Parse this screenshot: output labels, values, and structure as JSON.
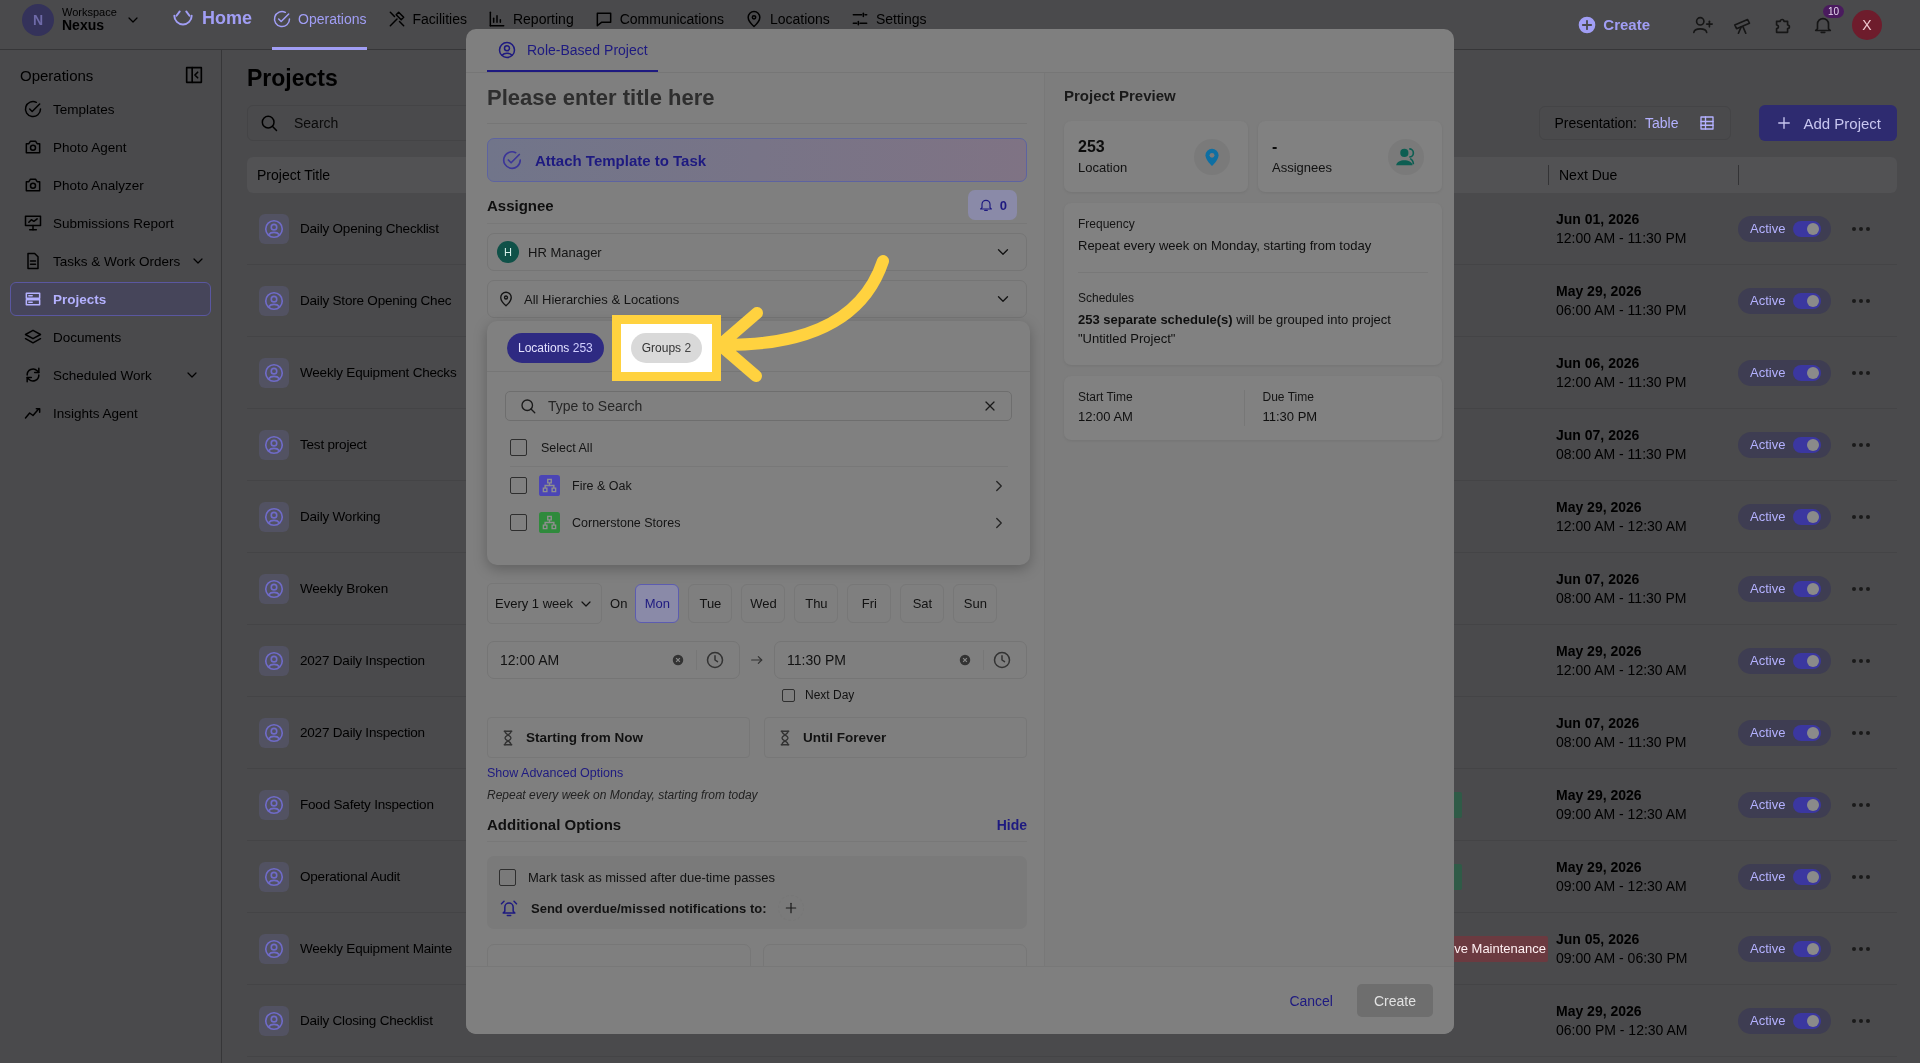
{
  "top_nav": {
    "workspace_label": "Workspace",
    "workspace_name": "Nexus",
    "workspace_initial": "N",
    "items": [
      {
        "label": "Home",
        "selected": false
      },
      {
        "label": "Operations",
        "selected": true
      },
      {
        "label": "Facilities",
        "selected": false
      },
      {
        "label": "Reporting",
        "selected": false
      },
      {
        "label": "Communications",
        "selected": false
      },
      {
        "label": "Locations",
        "selected": false
      },
      {
        "label": "Settings",
        "selected": false
      }
    ],
    "create_label": "Create",
    "notification_count": "10",
    "user_initial": "X"
  },
  "sidebar": {
    "title": "Operations",
    "items": [
      {
        "label": "Templates",
        "selected": false,
        "has_submenu": false
      },
      {
        "label": "Photo Agent",
        "selected": false,
        "has_submenu": false
      },
      {
        "label": "Photo Analyzer",
        "selected": false,
        "has_submenu": false
      },
      {
        "label": "Submissions Report",
        "selected": false,
        "has_submenu": false
      },
      {
        "label": "Tasks & Work Orders",
        "selected": false,
        "has_submenu": true
      },
      {
        "label": "Projects",
        "selected": true,
        "has_submenu": false
      },
      {
        "label": "Documents",
        "selected": false,
        "has_submenu": false
      },
      {
        "label": "Scheduled Work",
        "selected": false,
        "has_submenu": true
      },
      {
        "label": "Insights Agent",
        "selected": false,
        "has_submenu": false
      }
    ]
  },
  "page": {
    "title": "Projects",
    "search_placeholder": "Search",
    "presentation_label": "Presentation:",
    "presentation_value": "Table",
    "add_button": "Add Project"
  },
  "table": {
    "columns": [
      {
        "label": "Project Title"
      },
      {
        "label": "Next Due"
      }
    ],
    "rows": [
      {
        "title": "Daily Opening Checklist",
        "due_date": "Jun 01, 2026",
        "due_time": "12:00 AM - 11:30 PM",
        "status": "Active",
        "active": true
      },
      {
        "title": "Daily Store Opening Chec",
        "due_date": "May 29, 2026",
        "due_time": "06:00 AM - 11:30 PM",
        "status": "Active",
        "active": true
      },
      {
        "title": "Weekly Equipment Checks",
        "due_date": "Jun 06, 2026",
        "due_time": "12:00 AM - 11:30 PM",
        "status": "Active",
        "active": true
      },
      {
        "title": "Test project",
        "due_date": "Jun 07, 2026",
        "due_time": "08:00 AM - 11:30 PM",
        "status": "Active",
        "active": true
      },
      {
        "title": "Daily Working",
        "due_date": "May 29, 2026",
        "due_time": "12:00 AM - 12:30 AM",
        "status": "Active",
        "active": true
      },
      {
        "title": "Weekly Broken",
        "due_date": "Jun 07, 2026",
        "due_time": "08:00 AM - 11:30 PM",
        "status": "Active",
        "active": true
      },
      {
        "title": "2027 Daily Inspection",
        "due_date": "May 29, 2026",
        "due_time": "12:00 AM - 12:30 AM",
        "status": "Active",
        "active": true
      },
      {
        "title": "2027 Daily Inspection",
        "due_date": "Jun 07, 2026",
        "due_time": "08:00 AM - 11:30 PM",
        "status": "Active",
        "active": true
      },
      {
        "title": "Food Safety Inspection",
        "tag": {
          "color": "#2f5b47"
        },
        "due_date": "May 29, 2026",
        "due_time": "09:00 AM - 12:30 AM",
        "status": "Active",
        "active": true
      },
      {
        "title": "Operational Audit",
        "tag": {
          "color": "#2f5b47"
        },
        "due_date": "May 29, 2026",
        "due_time": "09:00 AM - 12:30 AM",
        "status": "Active",
        "active": true
      },
      {
        "title": "Weekly Equipment Mainte",
        "tag": {
          "text": "ve Maintenance",
          "color": "#6b3a40"
        },
        "due_date": "Jun 05, 2026",
        "due_time": "09:00 AM - 06:30 PM",
        "status": "Active",
        "active": true
      },
      {
        "title": "Daily Closing Checklist",
        "due_date": "May 29, 2026",
        "due_time": "06:00 PM - 12:30 AM",
        "status": "Active",
        "active": true
      }
    ]
  },
  "modal": {
    "tab": "Role-Based Project",
    "title_placeholder": "Please enter title here",
    "attach_label": "Attach Template to Task",
    "assignee_label": "Assignee",
    "notify_count": "0",
    "assignee": {
      "initial": "H",
      "name": "HR Manager"
    },
    "location_select": "All Hierarchies & Locations",
    "picker": {
      "tabs": [
        {
          "label": "Locations",
          "count": "253",
          "selected": true,
          "highlighted": false
        },
        {
          "label": "Groups",
          "count": "2",
          "selected": false,
          "highlighted": true
        }
      ],
      "search_placeholder": "Type to Search",
      "select_all": {
        "label": "Select All",
        "checked": false
      },
      "groups": [
        {
          "name": "Fire & Oak",
          "color": "#4b45b5",
          "checked": false
        },
        {
          "name": "Cornerstone Stores",
          "color": "#2f8a3c",
          "checked": false
        }
      ]
    },
    "interval": "Every 1 week",
    "on_label": "On",
    "days": [
      {
        "label": "Mon",
        "selected": true
      },
      {
        "label": "Tue",
        "selected": false
      },
      {
        "label": "Wed",
        "selected": false
      },
      {
        "label": "Thu",
        "selected": false
      },
      {
        "label": "Fri",
        "selected": false
      },
      {
        "label": "Sat",
        "selected": false
      },
      {
        "label": "Sun",
        "selected": false
      }
    ],
    "start_time": "12:00 AM",
    "end_time": "11:30 PM",
    "next_day": {
      "label": "Next Day",
      "checked": false
    },
    "start_label": "Starting from Now",
    "end_label": "Until Forever",
    "advanced_link": "Show Advanced Options",
    "summary": "Repeat every week on Monday, starting from today",
    "additional": {
      "title": "Additional Options",
      "toggle": "Hide",
      "missed": {
        "label": "Mark task as missed after due-time passes",
        "checked": false
      },
      "notify_label": "Send overdue/missed notifications to:"
    },
    "preview": {
      "title": "Project Preview",
      "stats": [
        {
          "value": "253",
          "label": "Location",
          "kind": "location"
        },
        {
          "value": "-",
          "label": "Assignees",
          "kind": "assignees"
        }
      ],
      "frequency_label": "Frequency",
      "frequency": "Repeat every week on Monday, starting from today",
      "schedules_label": "Schedules",
      "schedules": "**253 separate schedule(s)** will be grouped into project \"Untitled Project\"",
      "times": [
        {
          "label": "Start Time",
          "value": "12:00 AM"
        },
        {
          "label": "Due Time",
          "value": "11:30 PM"
        }
      ]
    },
    "footer": {
      "cancel": "Cancel",
      "create": "Create",
      "create_disabled": true
    }
  }
}
